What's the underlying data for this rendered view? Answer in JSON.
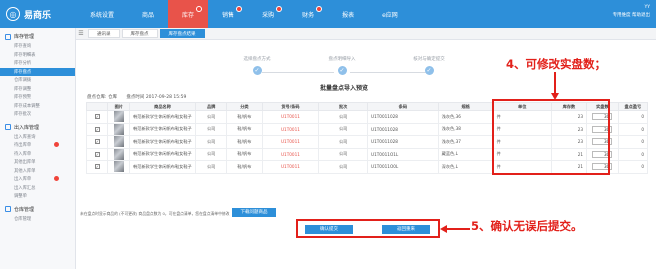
{
  "app": {
    "logo_text": "易商乐",
    "logo_icon": "logo-circle-icon",
    "nav": [
      {
        "label": "系统设置",
        "badge": false,
        "active": false
      },
      {
        "label": "商品",
        "badge": false,
        "active": false
      },
      {
        "label": "库存",
        "badge": true,
        "active": true
      },
      {
        "label": "销售",
        "badge": true,
        "active": false
      },
      {
        "label": "采购",
        "badge": true,
        "active": false
      },
      {
        "label": "财务",
        "badge": true,
        "active": false
      },
      {
        "label": "报表",
        "badge": false,
        "active": false
      },
      {
        "label": "e应网",
        "badge": false,
        "active": false
      }
    ],
    "top_right_line1": "YY",
    "top_right_line2": "专用维度  帮助退出"
  },
  "sidebar": {
    "group1_label": "库存管理",
    "group1_items": [
      {
        "label": "库存查询",
        "active": false,
        "dot": false
      },
      {
        "label": "库存明细表",
        "active": false,
        "dot": false
      },
      {
        "label": "库存分析",
        "active": false,
        "dot": false
      },
      {
        "label": "库存盘点",
        "active": true,
        "dot": false
      },
      {
        "label": "仓库调拨",
        "active": false,
        "dot": false
      },
      {
        "label": "库存调整",
        "active": false,
        "dot": false
      },
      {
        "label": "库存预警",
        "active": false,
        "dot": false
      },
      {
        "label": "库存成本调整",
        "active": false,
        "dot": false
      },
      {
        "label": "库存批次",
        "active": false,
        "dot": false
      }
    ],
    "group2_label": "出入库管理",
    "group2_items": [
      {
        "label": "出入库查询",
        "active": false,
        "dot": false
      },
      {
        "label": "待出库单",
        "active": false,
        "dot": true
      },
      {
        "label": "待入库单",
        "active": false,
        "dot": false
      },
      {
        "label": "其他出库单",
        "active": false,
        "dot": false
      },
      {
        "label": "其他入库单",
        "active": false,
        "dot": false
      },
      {
        "label": "出入库单",
        "active": false,
        "dot": true
      },
      {
        "label": "出入库汇总",
        "active": false,
        "dot": false
      },
      {
        "label": "调整单",
        "active": false,
        "dot": false
      }
    ],
    "group3_label": "仓库管理",
    "group3_items": [
      {
        "label": "仓库管理",
        "active": false,
        "dot": false
      }
    ]
  },
  "tabs": {
    "menu_icon": "hamburger-icon",
    "items": [
      {
        "label": "通讯录",
        "active": false
      },
      {
        "label": "库存盘点",
        "active": false
      },
      {
        "label": "库存盘点结果",
        "active": true
      }
    ]
  },
  "steps": [
    {
      "label": "选择盘点方式"
    },
    {
      "label": "盘点明细导入"
    },
    {
      "label": "核对与确定提交"
    }
  ],
  "page_title": "批量盘点导入预览",
  "meta": {
    "warehouse": "盘点仓库: 仓库",
    "date": "盘点时间 2017-09-28 15:59"
  },
  "table": {
    "headers": [
      "",
      "图片",
      "商品名称",
      "品牌",
      "分类",
      "货号/条码",
      "批次",
      "条码",
      "规格",
      "单位",
      "库存数",
      "实盘数",
      "盘点盈亏"
    ],
    "rows": [
      {
        "name": "韩范新款学生休闲帆布鞋女鞋子",
        "brand": "公司",
        "cat": "鞋/帆布",
        "code": "U1T0011",
        "batch": "公司",
        "barcode": "U1T0011028",
        "spec": "浅灰色,36",
        "unit": "件",
        "stock": "23",
        "actual": "30",
        "diff": "0"
      },
      {
        "name": "韩范新款学生休闲帆布鞋女鞋子",
        "brand": "公司",
        "cat": "鞋/帆布",
        "code": "U1T0011",
        "batch": "公司",
        "barcode": "U1T0011028",
        "spec": "浅灰色,38",
        "unit": "件",
        "stock": "23",
        "actual": "30",
        "diff": "0"
      },
      {
        "name": "韩范新款学生休闲帆布鞋女鞋子",
        "brand": "公司",
        "cat": "鞋/帆布",
        "code": "U1T0011",
        "batch": "公司",
        "barcode": "U1T0011028",
        "spec": "浅灰色,37",
        "unit": "件",
        "stock": "23",
        "actual": "30",
        "diff": "0"
      },
      {
        "name": "韩范新款学生休闲帆布鞋女鞋子",
        "brand": "公司",
        "cat": "鞋/帆布",
        "code": "U1T0011",
        "batch": "公司",
        "barcode": "U1T0011O1L",
        "spec": "藏蓝色,L",
        "unit": "件",
        "stock": "21",
        "actual": "30",
        "diff": "0"
      },
      {
        "name": "韩范新款学生休闲帆布鞋女鞋子",
        "brand": "公司",
        "cat": "鞋/帆布",
        "code": "U1T0011",
        "batch": "公司",
        "barcode": "U1T0011O0L",
        "spec": "深灰色,L",
        "unit": "件",
        "stock": "21",
        "actual": "30",
        "diff": "0"
      }
    ]
  },
  "note": "未在盘点时显示商品的 (不可更改) 商品盘点数为 0，可在盘点清单，您在盘点清单中修改",
  "import_button": "下载问题商品",
  "buttons": {
    "prev": "确认提交",
    "cancel": "返回重来"
  },
  "annotations": {
    "text1": "4、可修改实盘数；",
    "text2": "5、确认无误后提交。",
    "color": "#e2201a"
  }
}
